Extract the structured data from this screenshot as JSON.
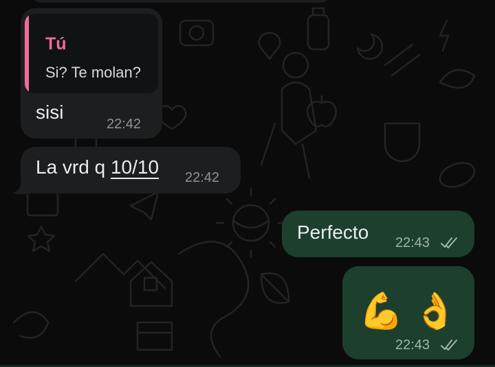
{
  "chat": {
    "quote": {
      "author": "Tú",
      "text": "Si? Te molan?"
    },
    "messages": [
      {
        "direction": "in",
        "text": "sisi",
        "time": "22:42"
      },
      {
        "direction": "in",
        "text_prefix": "La vrd q ",
        "text_link": "10/10",
        "time": "22:42"
      },
      {
        "direction": "out",
        "text": "Perfecto",
        "time": "22:43",
        "status": "read"
      },
      {
        "direction": "out",
        "text": "💪👌",
        "time": "22:43",
        "status": "read"
      }
    ]
  },
  "colors": {
    "incoming_bubble": "#1d1e20",
    "outgoing_bubble": "#1d3f2e",
    "quote_accent": "#f26b9a",
    "read_ticks": "#9fb7aa"
  },
  "icons": {
    "read_status": "double-check-icon",
    "emoji_1": "flexed-biceps",
    "emoji_2": "ok-hand"
  }
}
